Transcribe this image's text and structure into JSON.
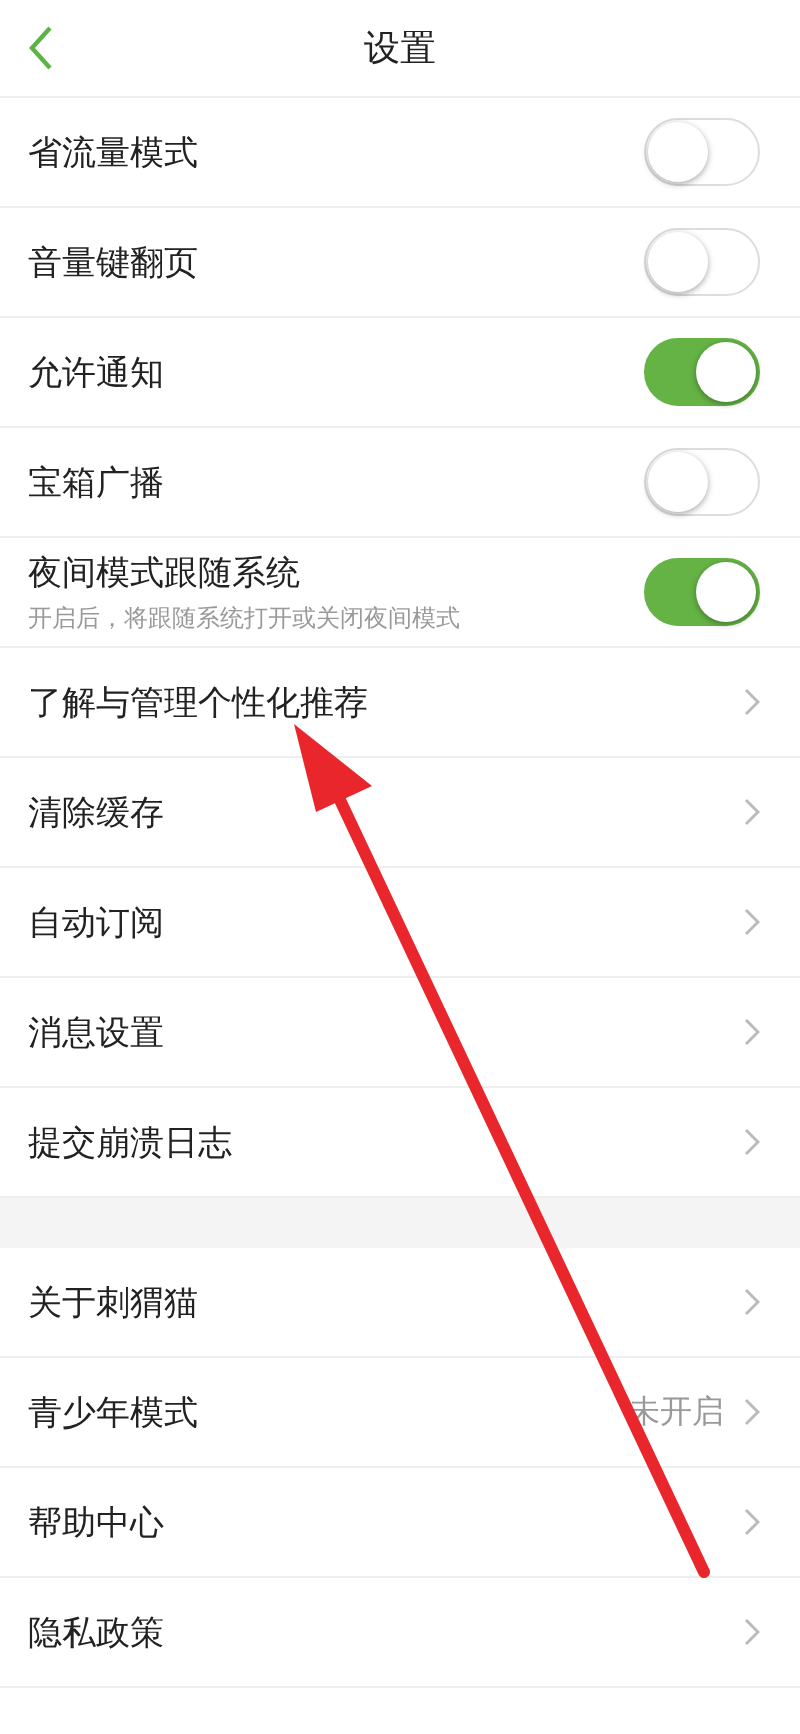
{
  "header": {
    "title": "设置"
  },
  "sections": [
    {
      "items": [
        {
          "kind": "toggle",
          "label": "省流量模式",
          "on": false
        },
        {
          "kind": "toggle",
          "label": "音量键翻页",
          "on": false
        },
        {
          "kind": "toggle",
          "label": "允许通知",
          "on": true
        },
        {
          "kind": "toggle",
          "label": "宝箱广播",
          "on": false
        },
        {
          "kind": "toggle",
          "label": "夜间模式跟随系统",
          "subtitle": "开启后，将跟随系统打开或关闭夜间模式",
          "on": true
        },
        {
          "kind": "link",
          "label": "了解与管理个性化推荐"
        },
        {
          "kind": "link",
          "label": "清除缓存"
        },
        {
          "kind": "link",
          "label": "自动订阅"
        },
        {
          "kind": "link",
          "label": "消息设置"
        },
        {
          "kind": "link",
          "label": "提交崩溃日志"
        }
      ]
    },
    {
      "items": [
        {
          "kind": "link",
          "label": "关于刺猬猫"
        },
        {
          "kind": "link",
          "label": "青少年模式",
          "value": "未开启"
        },
        {
          "kind": "link",
          "label": "帮助中心"
        },
        {
          "kind": "link",
          "label": "隐私政策"
        }
      ]
    }
  ],
  "annotation": {
    "kind": "arrow"
  }
}
